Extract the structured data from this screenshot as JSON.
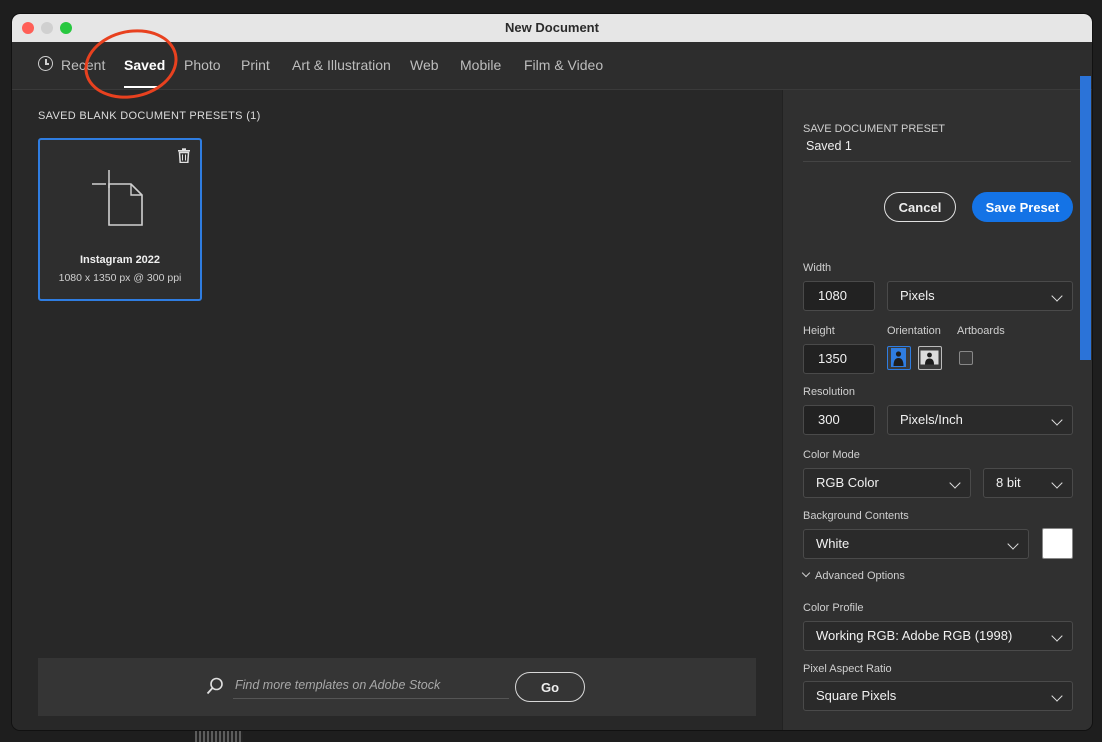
{
  "window": {
    "title": "New Document"
  },
  "tabs": [
    {
      "label": "Recent"
    },
    {
      "label": "Saved"
    },
    {
      "label": "Photo"
    },
    {
      "label": "Print"
    },
    {
      "label": "Art & Illustration"
    },
    {
      "label": "Web"
    },
    {
      "label": "Mobile"
    },
    {
      "label": "Film & Video"
    }
  ],
  "active_tab": "Saved",
  "left": {
    "section_title": "SAVED BLANK DOCUMENT PRESETS",
    "section_count": "(1)",
    "presets": [
      {
        "name": "Instagram 2022",
        "meta": "1080 x 1350 px @ 300 ppi"
      }
    ]
  },
  "search": {
    "placeholder": "Find more templates on Adobe Stock",
    "go_label": "Go"
  },
  "right": {
    "header": "SAVE DOCUMENT PRESET",
    "preset_name": "Saved 1",
    "cancel_label": "Cancel",
    "save_label": "Save Preset",
    "width_label": "Width",
    "width_value": "1080",
    "width_unit": "Pixels",
    "height_label": "Height",
    "height_value": "1350",
    "orientation_label": "Orientation",
    "artboards_label": "Artboards",
    "resolution_label": "Resolution",
    "resolution_value": "300",
    "resolution_unit": "Pixels/Inch",
    "color_mode_label": "Color Mode",
    "color_mode": "RGB Color",
    "bit_depth": "8 bit",
    "bg_label": "Background Contents",
    "bg_value": "White",
    "bg_swatch_color": "#ffffff",
    "advanced_label": "Advanced Options",
    "profile_label": "Color Profile",
    "profile_value": "Working RGB: Adobe RGB (1998)",
    "aspect_label": "Pixel Aspect Ratio",
    "aspect_value": "Square Pixels"
  },
  "colors": {
    "accent": "#1473e6",
    "annotation": "#e8411f"
  }
}
